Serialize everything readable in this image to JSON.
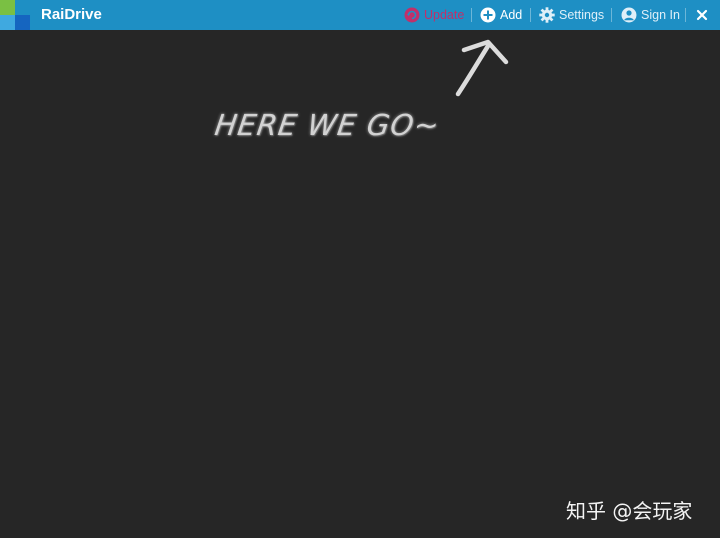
{
  "app": {
    "title": "RaiDrive"
  },
  "toolbar": {
    "update_label": "Update",
    "add_label": "Add",
    "settings_label": "Settings",
    "signin_label": "Sign In"
  },
  "canvas": {
    "annotation_text": "HERE WE GO~"
  },
  "watermark": {
    "text": "知乎 @会玩家"
  },
  "colors": {
    "titlebar": "#1e8fc4",
    "background": "#262626",
    "update": "#c0306a",
    "logo_green": "#7ac043",
    "logo_blue": "#1565c0"
  },
  "icons": {
    "update": "refresh-circle-icon",
    "add": "plus-circle-icon",
    "settings": "gear-icon",
    "signin": "user-circle-icon",
    "close": "close-icon"
  }
}
